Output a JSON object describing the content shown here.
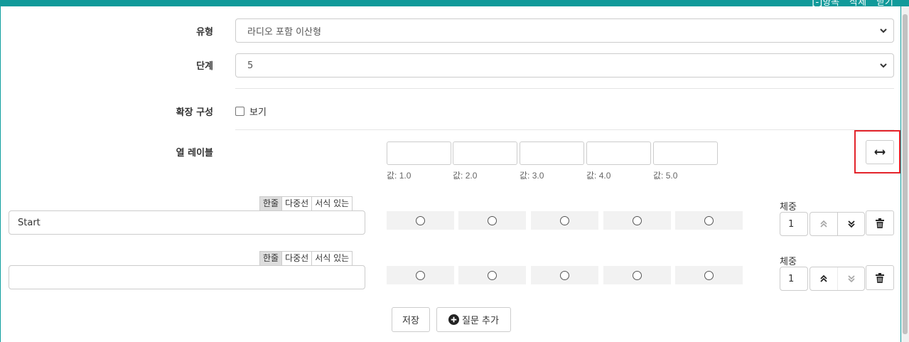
{
  "toolbar": {
    "items": [
      "[-]항목",
      "삭제",
      "닫기"
    ]
  },
  "form": {
    "type_label": "유형",
    "type_value": "라디오 포함 이산형",
    "step_label": "단계",
    "step_value": "5",
    "ext_label": "확장 구성",
    "ext_checkbox_label": "보기",
    "col_label": "열 레이블",
    "col_values": [
      "값: 1.0",
      "값: 2.0",
      "값: 3.0",
      "값: 4.0",
      "값: 5.0"
    ]
  },
  "questions": [
    {
      "tabs": [
        "한줄",
        "다중선",
        "서식 있는"
      ],
      "text": "Start",
      "weight_label": "체중",
      "weight": "1",
      "up_enabled": false,
      "down_enabled": true
    },
    {
      "tabs": [
        "한줄",
        "다중선",
        "서식 있는"
      ],
      "text": "",
      "weight_label": "체중",
      "weight": "1",
      "up_enabled": true,
      "down_enabled": false
    }
  ],
  "actions": {
    "save_label": "저장",
    "add_label": "질문 추가"
  },
  "colors": {
    "teal": "#119a9a",
    "highlight": "#e3242b"
  },
  "icons": [
    "swap-horizontal-icon",
    "chevrons-up-icon",
    "chevrons-down-icon",
    "trash-icon",
    "plus-circle-icon",
    "chevron-down-icon"
  ]
}
